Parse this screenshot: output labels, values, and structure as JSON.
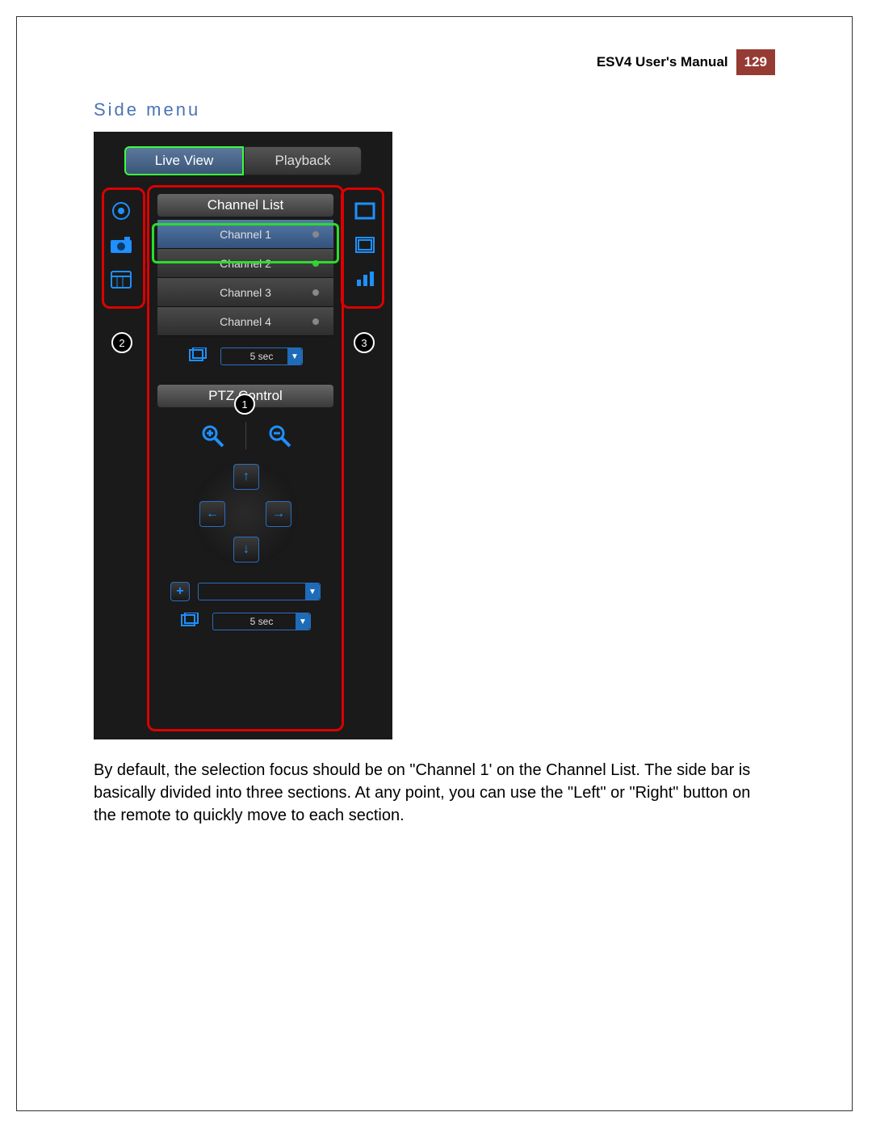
{
  "header": {
    "title": "ESV4 User's Manual",
    "page": "129"
  },
  "section_title": "Side menu",
  "tabs": {
    "live_view": "Live View",
    "playback": "Playback"
  },
  "channel_list": {
    "header": "Channel List",
    "items": [
      {
        "label": "Channel 1",
        "status": "grey"
      },
      {
        "label": "Channel 2",
        "status": "green"
      },
      {
        "label": "Channel 3",
        "status": "grey"
      },
      {
        "label": "Channel 4",
        "status": "grey"
      }
    ],
    "sequence_interval": "5 sec"
  },
  "ptz": {
    "header": "PTZ Control",
    "preset_value": "",
    "tour_interval": "5 sec"
  },
  "left_icons": [
    "record-icon",
    "camera-icon",
    "calendar-icon"
  ],
  "right_icons": [
    "fullscreen-icon",
    "window-icon",
    "bars-icon"
  ],
  "callouts": {
    "center": "1",
    "left": "2",
    "right": "3"
  },
  "body_text": "By default, the selection focus should be on \"Channel 1' on the Channel List. The side bar is basically divided into three sections. At any point, you can use the \"Left\" or \"Right\" button on the remote to quickly move to each section."
}
